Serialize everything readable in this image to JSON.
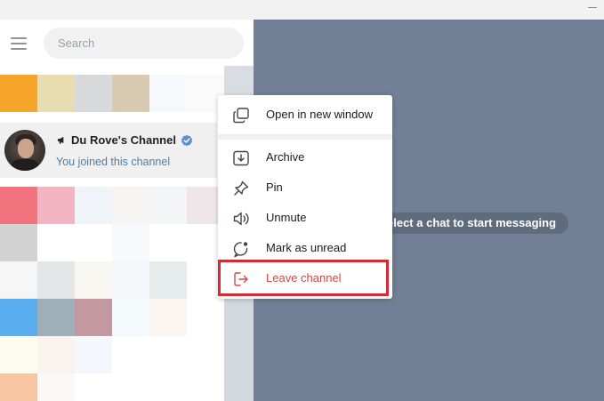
{
  "window": {
    "title": ""
  },
  "sidebar": {
    "search": {
      "placeholder": "Search"
    },
    "chat": {
      "title": "Du Rove's Channel",
      "subtitle": "You joined this channel",
      "verified": true
    }
  },
  "main": {
    "hint": "elect a chat to start messaging"
  },
  "context_menu": {
    "items": [
      {
        "label": "Open in new window",
        "icon": "open-new-window-icon"
      },
      {
        "label": "Archive",
        "icon": "archive-icon"
      },
      {
        "label": "Pin",
        "icon": "pin-icon"
      },
      {
        "label": "Unmute",
        "icon": "unmute-icon"
      },
      {
        "label": "Mark as unread",
        "icon": "mark-unread-icon"
      },
      {
        "label": "Leave channel",
        "icon": "leave-icon"
      }
    ]
  },
  "colors": {
    "main_bg": "#718096",
    "accent_link": "#4a7fa8",
    "danger": "#d14848",
    "highlight_border": "#d52b35",
    "verified_badge": "#5b8fd1"
  }
}
